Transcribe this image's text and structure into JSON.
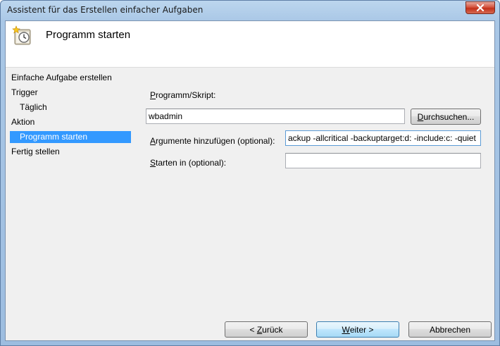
{
  "window": {
    "title": "Assistent für das Erstellen einfacher Aufgaben"
  },
  "header": {
    "title": "Programm starten",
    "icon": "task-scheduler-icon"
  },
  "nav": {
    "items": [
      {
        "label": "Einfache Aufgabe erstellen"
      },
      {
        "label": "Trigger"
      },
      {
        "label": "Täglich"
      },
      {
        "label": "Aktion"
      },
      {
        "label": "Programm starten"
      },
      {
        "label": "Fertig stellen"
      }
    ],
    "selected_index": 4,
    "selected_color": "#3399ff"
  },
  "form": {
    "program_label_key": "P",
    "program_label_rest": "rogramm/Skript:",
    "program_value": "wbadmin",
    "browse_key": "D",
    "browse_rest": "urchsuchen...",
    "args_label_key": "A",
    "args_label_rest": "rgumente hinzufügen (optional):",
    "args_value": "ackup -allcritical -backuptarget:d: -include:c: -quiet",
    "start_label_key": "S",
    "start_label_rest": "tarten in (optional):",
    "start_value": ""
  },
  "footer": {
    "back_prefix": "< ",
    "back_key": "Z",
    "back_rest": "urück",
    "next_key": "W",
    "next_rest": "eiter >",
    "cancel_label": "Abbrechen"
  }
}
